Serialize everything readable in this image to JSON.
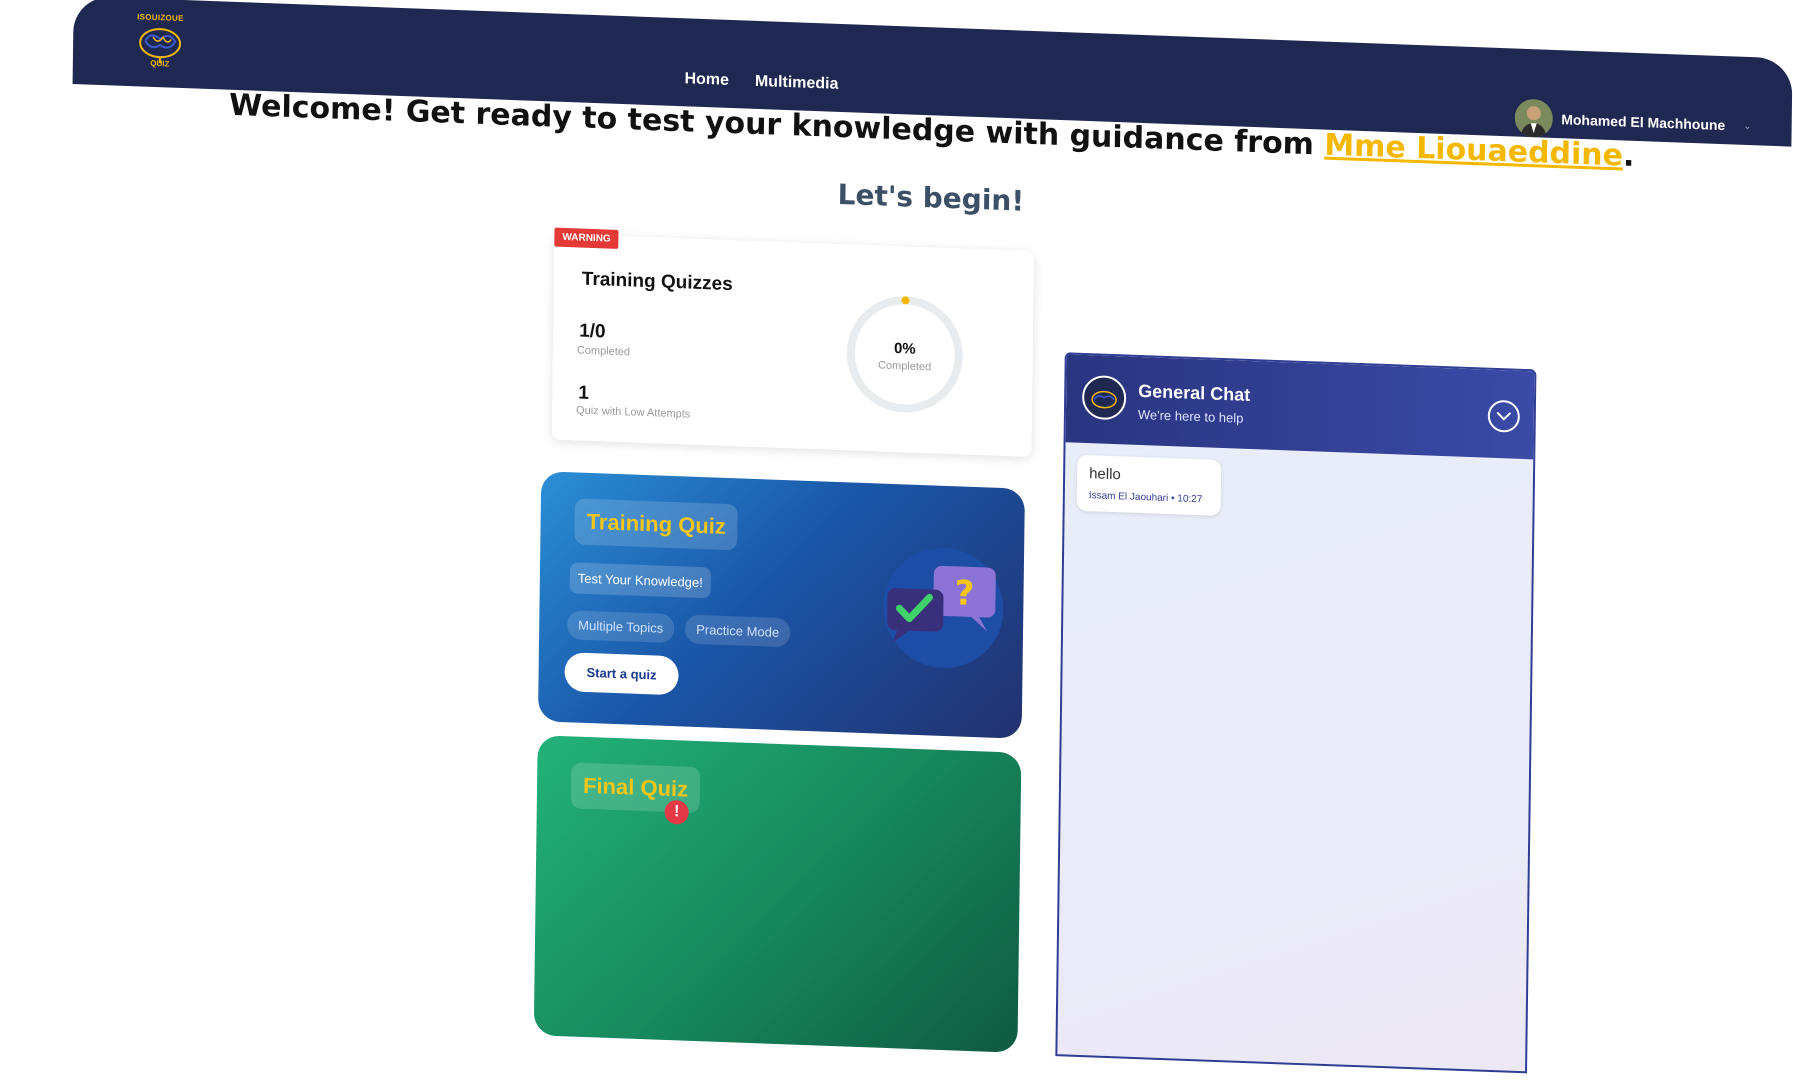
{
  "brand": {
    "logo_text_top": "ISOUIZOUE",
    "logo_text_bottom": "QUIZ"
  },
  "nav": {
    "items": [
      "Home",
      "Multimedia"
    ]
  },
  "user": {
    "name": "Mohamed El Machhoune"
  },
  "welcome": {
    "prefix": "Welcome! Get ready to test your knowledge with guidance from ",
    "teacher": "Mme Liouaeddine",
    "suffix": ".",
    "begin": "Let's begin!"
  },
  "stats": {
    "badge": "WARNING",
    "title": "Training Quizzes",
    "completed_value": "1/0",
    "completed_label": "Completed",
    "low_value": "1",
    "low_label": "Quiz with Low Attempts",
    "ring_percent": "0%",
    "ring_label": "Completed",
    "ring_fraction": 0
  },
  "training_quiz": {
    "title": "Training Quiz",
    "tagline": "Test Your Knowledge!",
    "chips": [
      "Multiple Topics",
      "Practice Mode"
    ],
    "button": "Start a quiz"
  },
  "final_quiz": {
    "title": "Final Quiz",
    "alert": "!"
  },
  "chat": {
    "title": "General Chat",
    "subtitle": "We're here to help",
    "messages": [
      {
        "text": "hello",
        "meta": "Issam El Jaouhari • 10:27"
      }
    ]
  },
  "colors": {
    "nav_bg": "#1e2850",
    "accent": "#f5b800",
    "warning": "#e53935",
    "chat_header": "#2f3d94"
  }
}
